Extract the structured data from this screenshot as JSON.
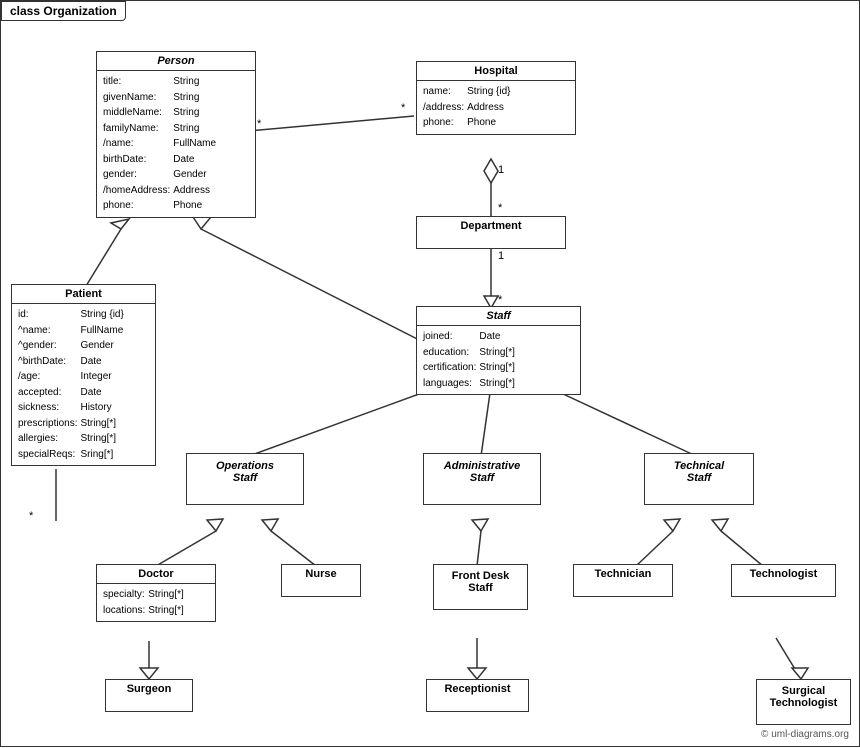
{
  "title": "class Organization",
  "classes": {
    "person": {
      "name": "Person",
      "italic": true,
      "attrs": [
        [
          "title:",
          "String"
        ],
        [
          "givenName:",
          "String"
        ],
        [
          "middleName:",
          "String"
        ],
        [
          "familyName:",
          "String"
        ],
        [
          "/name:",
          "FullName"
        ],
        [
          "birthDate:",
          "Date"
        ],
        [
          "gender:",
          "Gender"
        ],
        [
          "/homeAddress:",
          "Address"
        ],
        [
          "phone:",
          "Phone"
        ]
      ]
    },
    "hospital": {
      "name": "Hospital",
      "italic": false,
      "attrs": [
        [
          "name:",
          "String {id}"
        ],
        [
          "/address:",
          "Address"
        ],
        [
          "phone:",
          "Phone"
        ]
      ]
    },
    "patient": {
      "name": "Patient",
      "italic": false,
      "attrs": [
        [
          "id:",
          "String {id}"
        ],
        [
          "^name:",
          "FullName"
        ],
        [
          "^gender:",
          "Gender"
        ],
        [
          "^birthDate:",
          "Date"
        ],
        [
          "/age:",
          "Integer"
        ],
        [
          "accepted:",
          "Date"
        ],
        [
          "sickness:",
          "History"
        ],
        [
          "prescriptions:",
          "String[*]"
        ],
        [
          "allergies:",
          "String[*]"
        ],
        [
          "specialReqs:",
          "Sring[*]"
        ]
      ]
    },
    "department": {
      "name": "Department",
      "italic": false,
      "attrs": []
    },
    "staff": {
      "name": "Staff",
      "italic": true,
      "attrs": [
        [
          "joined:",
          "Date"
        ],
        [
          "education:",
          "String[*]"
        ],
        [
          "certification:",
          "String[*]"
        ],
        [
          "languages:",
          "String[*]"
        ]
      ]
    },
    "operations_staff": {
      "name": "Operations\nStaff",
      "italic": true,
      "attrs": []
    },
    "administrative_staff": {
      "name": "Administrative\nStaff",
      "italic": true,
      "attrs": []
    },
    "technical_staff": {
      "name": "Technical\nStaff",
      "italic": true,
      "attrs": []
    },
    "doctor": {
      "name": "Doctor",
      "italic": false,
      "attrs": [
        [
          "specialty:",
          "String[*]"
        ],
        [
          "locations:",
          "String[*]"
        ]
      ]
    },
    "nurse": {
      "name": "Nurse",
      "italic": false,
      "attrs": []
    },
    "front_desk_staff": {
      "name": "Front Desk\nStaff",
      "italic": false,
      "attrs": []
    },
    "technician": {
      "name": "Technician",
      "italic": false,
      "attrs": []
    },
    "technologist": {
      "name": "Technologist",
      "italic": false,
      "attrs": []
    },
    "surgeon": {
      "name": "Surgeon",
      "italic": false,
      "attrs": []
    },
    "receptionist": {
      "name": "Receptionist",
      "italic": false,
      "attrs": []
    },
    "surgical_technologist": {
      "name": "Surgical\nTechnologist",
      "italic": false,
      "attrs": []
    }
  },
  "copyright": "© uml-diagrams.org"
}
